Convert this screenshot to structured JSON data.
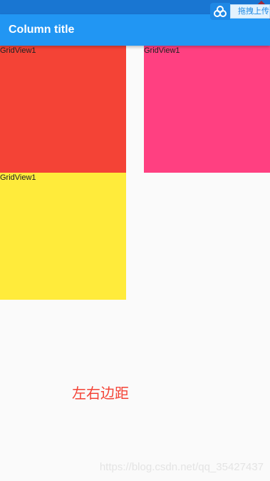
{
  "app_bar": {
    "title": "Column title",
    "color": "#2196f3",
    "status_bar_color": "#1976d2"
  },
  "overlay": {
    "icon": "cloud-link-icon",
    "label": "拖拽上传"
  },
  "grid": {
    "tiles": [
      {
        "label": "GridView1",
        "color": "#f44336"
      },
      {
        "label": "GridView1",
        "color": "#ff4081"
      },
      {
        "label": "GridView1",
        "color": "#ffeb3b"
      }
    ]
  },
  "annotation": {
    "text": "左右边距",
    "color": "#f44336"
  },
  "watermark": {
    "text": "https://blog.csdn.net/qq_35427437"
  }
}
